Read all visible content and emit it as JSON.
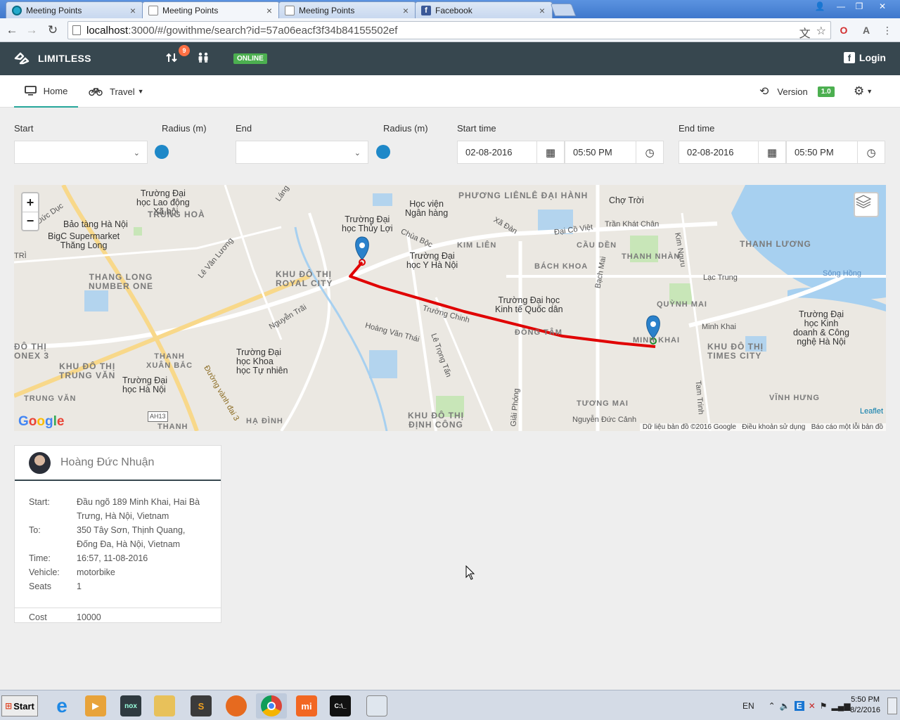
{
  "browser": {
    "tabs": [
      {
        "title": "Meeting Points",
        "active": false,
        "icon": "circle-app-icon"
      },
      {
        "title": "Meeting Points",
        "active": true,
        "icon": "document-icon"
      },
      {
        "title": "Meeting Points",
        "active": false,
        "icon": "document-icon"
      },
      {
        "title": "Facebook",
        "active": false,
        "icon": "facebook-icon"
      }
    ],
    "url_host": "localhost",
    "url_rest": ":3000/#/gowithme/search?id=57a06eacf3f34b84155502ef"
  },
  "app_nav": {
    "brand": "LIMITLESS",
    "notification_count": "9",
    "status": "ONLINE",
    "login_label": "Login"
  },
  "sub_nav": {
    "home_label": "Home",
    "travel_label": "Travel",
    "version_label": "Version",
    "version_value": "1.0"
  },
  "filters": {
    "start_label": "Start",
    "radius_label_1": "Radius (m)",
    "end_label": "End",
    "radius_label_2": "Radius (m)",
    "start_time_label": "Start time",
    "end_time_label": "End time",
    "start_date": "02-08-2016",
    "start_time": "05:50 PM",
    "end_date": "02-08-2016",
    "end_time": "05:50 PM"
  },
  "map": {
    "labels": {
      "phuong_lien": "PHƯƠNG LIÊN",
      "le_dai_hanh": "LÊ ĐẠI HÀNH",
      "cho_troi": "Chợ Trời",
      "tran_khat_chan": "Trần Khát Chân",
      "thanh_luong": "THANH LƯƠNG",
      "hoc_vien_ngan_hang": "Học viện\nNgân hàng",
      "truong_dai_hoc_thuy_loi": "Trường Đại\nhọc Thủy Lợi",
      "truong_dai_hoc_lao_dong": "Trường Đại\nhọc Lao động\n- Xã hội",
      "trung_hoa": "TRUNG HOÀ",
      "bao_tang": "Bảo tàng Hà Nội",
      "bigc": "BigC Supermarket\nThăng Long",
      "thang_long": "THANG LONG\nNUMBER ONE",
      "royal_city": "KHU ĐÔ THỊ\nROYAL CITY",
      "truong_y": "Trường Đại\nhọc Y Hà Nội",
      "kim_lien": "KIM LIÊN",
      "cau_den": "CẦU DỀN",
      "bach_khoa": "BÁCH KHOA",
      "thanh_nhan": "THANH NHÀN",
      "quynh_mai": "QUỲNH MAI",
      "lac_trung": "Lạc Trung",
      "song_hong": "Sông Hồng",
      "kinh_te_qd": "Trường Đại học\nKinh tế Quốc dân",
      "dong_tam": "ĐỒNG TÂM",
      "minh_khai": "MINH KHAI",
      "minh_khai_road": "Minh Khai",
      "times_city": "KHU ĐÔ THỊ\nTIMES CITY",
      "kinh_doanh": "Trường Đại\nhọc Kinh\ndoanh & Công\nnghệ Hà Nội",
      "do_thi_onex": "ĐÔ THỊ\nONEX 3",
      "trung_van_kdt": "KHU ĐÔ THỊ\nTRUNG VĂN",
      "thanh_xuan_bac": "THANH\nXUÂN BẮC",
      "khoa_hoc_tu_nhien": "Trường Đại\nhọc Khoa\nhọc Tự nhiên",
      "dai_hoc_ha_noi": "Trường Đại\nhọc Hà Nội",
      "trung_van": "TRUNG VĂN",
      "thanh": "THANH",
      "ha_dinh": "HẠ ĐÌNH",
      "dinh_cong": "KHU ĐÔ THỊ\nĐỊNH CÔNG",
      "tuong_mai": "TƯƠNG MAI",
      "vinh_hung": "VĨNH HƯNG",
      "nguyen_duc_canh": "Nguyễn Đức Cảnh",
      "hoang_van_thai": "Hoàng Văn Thái",
      "nguyen_trai": "Nguyễn Trãi",
      "vanh_dai_3": "Đường vành đai 3",
      "ah13": "AH13",
      "tri": "TRÌ",
      "do_duc_duc": "Đỗ Đức Dục",
      "lang": "Láng",
      "chua_boc": "Chùa Bộc",
      "xa_dan": "Xã Đàn",
      "dai_co_viet": "Đại Cồ Việt",
      "le_van_luong": "Lê Văn Lương",
      "bach_mai": "Bạch Mai",
      "kim_nguu": "Kim Ngưu",
      "truong_chinh": "Trường Chinh",
      "le_trong_tan": "Lê Trọng Tấn",
      "giai_phong": "Giải Phóng",
      "tam_trinh": "Tam Trinh"
    },
    "zoom_in": "+",
    "zoom_out": "−",
    "leaflet": "Leaflet",
    "google": "Google",
    "attribution": "Dữ liệu bản đồ ©2016 Google   Điều khoản sử dụng   Báo cáo một lỗi bản đồ",
    "route_color": "#e00000"
  },
  "trip_card": {
    "name": "Hoàng Đức Nhuận",
    "start_key": "Start:",
    "start_val": "Đầu ngõ 189 Minh Khai, Hai Bà Trưng, Hà Nội, Vietnam",
    "to_key": "To:",
    "to_val": "350 Tây Sơn, Thịnh Quang, Đống Đa, Hà Nội, Vietnam",
    "time_key": "Time:",
    "time_val": "16:57, 11-08-2016",
    "vehicle_key": "Vehicle:",
    "vehicle_val": "motorbike",
    "seats_key": "Seats",
    "seats_val": "1",
    "cost_key": "Cost",
    "cost_val": "10000"
  },
  "taskbar": {
    "start_label": "Start",
    "lang": "EN",
    "clock_time": "5:50 PM",
    "clock_date": "8/2/2016"
  }
}
